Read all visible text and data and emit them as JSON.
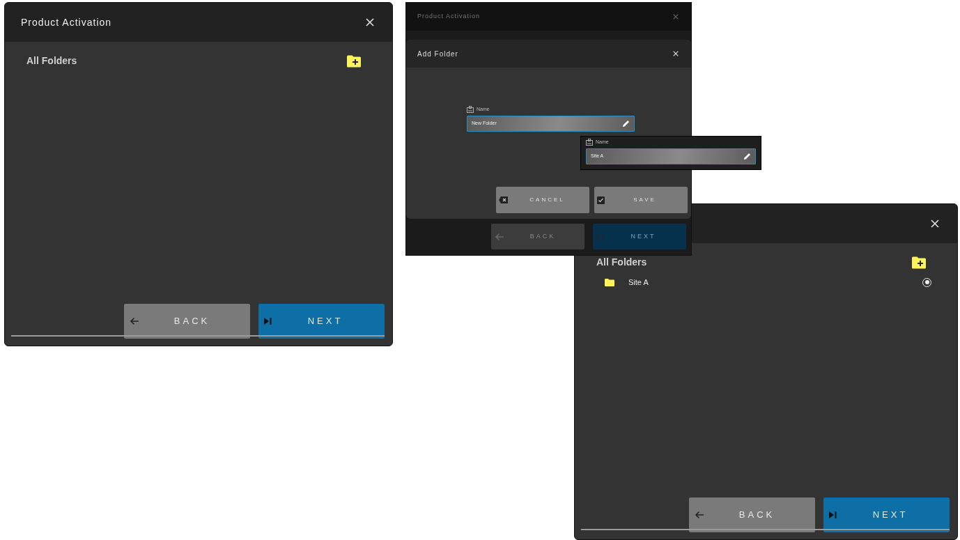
{
  "screens": [
    {
      "kind": "folders",
      "title": "Product Activation",
      "heading": "All Folders",
      "back": "BACK",
      "next": "NEXT"
    },
    {
      "kind": "dialog",
      "title": "Product Activation",
      "dialog_title": "Add Folder",
      "field": {
        "label": "Name",
        "value": "New Folder"
      },
      "cancel": "CANCEL",
      "save": "SAVE",
      "back": "BACK",
      "next": "NEXT"
    },
    {
      "kind": "folders",
      "heading": "All Folders",
      "folders": [
        {
          "name": "Site A",
          "selected": true
        }
      ],
      "back": "BACK",
      "next": "NEXT"
    }
  ],
  "callout": {
    "label": "Name",
    "value": "Site A"
  }
}
